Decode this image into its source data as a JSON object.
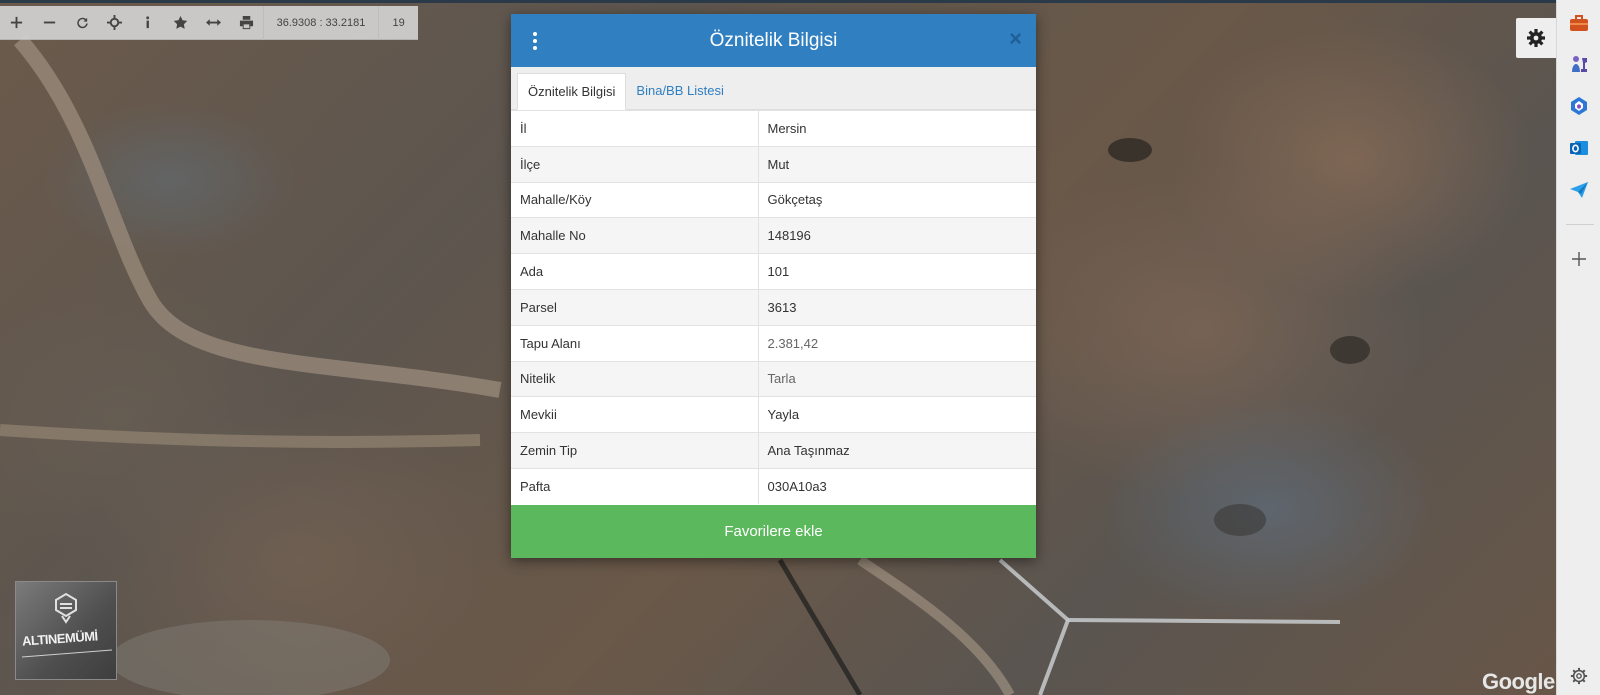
{
  "toolbar": {
    "buttons": [
      "zoom-in",
      "zoom-out",
      "refresh",
      "locate",
      "info",
      "favorites",
      "measure",
      "print"
    ],
    "coordinates": "36.9308 : 33.2181",
    "zoom_level": "19"
  },
  "dialog": {
    "title": "Öznitelik Bilgisi",
    "close_label": "×",
    "tabs": [
      {
        "label": "Öznitelik Bilgisi",
        "active": true
      },
      {
        "label": "Bina/BB Listesi",
        "active": false
      }
    ],
    "rows": [
      {
        "key": "İl",
        "value": "Mersin"
      },
      {
        "key": "İlçe",
        "value": "Mut"
      },
      {
        "key": "Mahalle/Köy",
        "value": "Gökçetaş"
      },
      {
        "key": "Mahalle No",
        "value": "148196"
      },
      {
        "key": "Ada",
        "value": "101"
      },
      {
        "key": "Parsel",
        "value": "3613"
      },
      {
        "key": "Tapu Alanı",
        "value": "2.381,42"
      },
      {
        "key": "Nitelik",
        "value": "Tarla"
      },
      {
        "key": "Mevkii",
        "value": "Yayla"
      },
      {
        "key": "Zemin Tip",
        "value": "Ana Taşınmaz"
      },
      {
        "key": "Pafta",
        "value": "030A10a3"
      }
    ],
    "favorite_button": "Favorilere ekle"
  },
  "logo": {
    "text": "ALTINEMÜMİ"
  },
  "attribution": "Google",
  "sidebar_icons": [
    "briefcase-icon",
    "chess-icon",
    "copilot-icon",
    "outlook-icon",
    "send-icon",
    "plus-icon",
    "settings-icon"
  ],
  "colors": {
    "header": "#2f7fc1",
    "favorite": "#5cb85c",
    "tab_link": "#2f7fc1"
  }
}
